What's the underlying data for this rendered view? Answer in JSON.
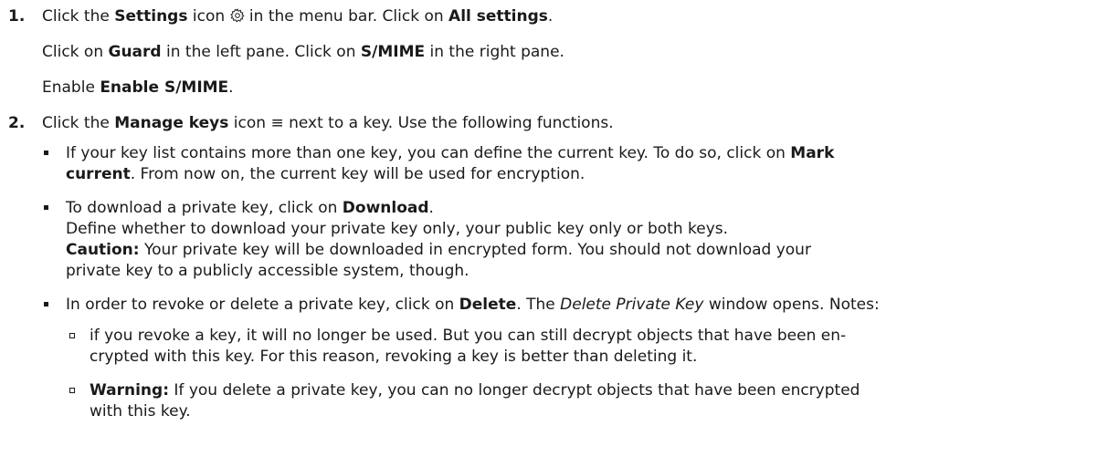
{
  "steps": [
    {
      "number": "1.",
      "line1": {
        "t1": "Click the ",
        "b1": "Settings",
        "t2": " icon ",
        "icon": "gear-icon",
        "t3": " in the menu bar. Click on ",
        "b2": "All settings",
        "t4": "."
      },
      "line2": {
        "t1": "Click on ",
        "b1": "Guard",
        "t2": " in the left pane. Click on ",
        "b2": "S/MIME",
        "t3": " in the right pane."
      },
      "line3": {
        "t1": "Enable ",
        "b1": "Enable S/MIME",
        "t2": "."
      }
    },
    {
      "number": "2.",
      "line1": {
        "t1": "Click the ",
        "b1": "Manage keys",
        "t2": " icon ",
        "icon_glyph": "≡",
        "t3": " next to a key. Use the following functions."
      },
      "bullets": [
        {
          "l1_t1": "If your key list contains more than one key, you can define the current key. To do so, click on ",
          "l1_b1": "Mark",
          "l2_b1": "current",
          "l2_t1": ". From now on, the current key will be used for encryption."
        },
        {
          "l1_t1": "To download a private key, click on ",
          "l1_b1": "Download",
          "l1_t2": ".",
          "l2": "Define whether to download your private key only, your public key only or both keys.",
          "l3_b1": "Caution:",
          "l3_t1": " Your private key will be downloaded in encrypted form. You should not download your",
          "l4": "private key to a publicly accessible system, though."
        },
        {
          "l1_t1": "In order to revoke or delete a private key, click on ",
          "l1_b1": "Delete",
          "l1_t2": ". The ",
          "l1_i1": "Delete Private Key",
          "l1_t3": " window opens. Notes:",
          "sub": [
            {
              "l1": "if you revoke a key, it will no longer be used. But you can still decrypt objects that have been en-",
              "l2": "crypted with this key. For this reason, revoking a key is better than deleting it."
            },
            {
              "l1_b1": "Warning:",
              "l1_t1": " If you delete a private key, you can no longer decrypt objects that have been encrypted",
              "l2": "with this key."
            }
          ]
        }
      ]
    }
  ]
}
